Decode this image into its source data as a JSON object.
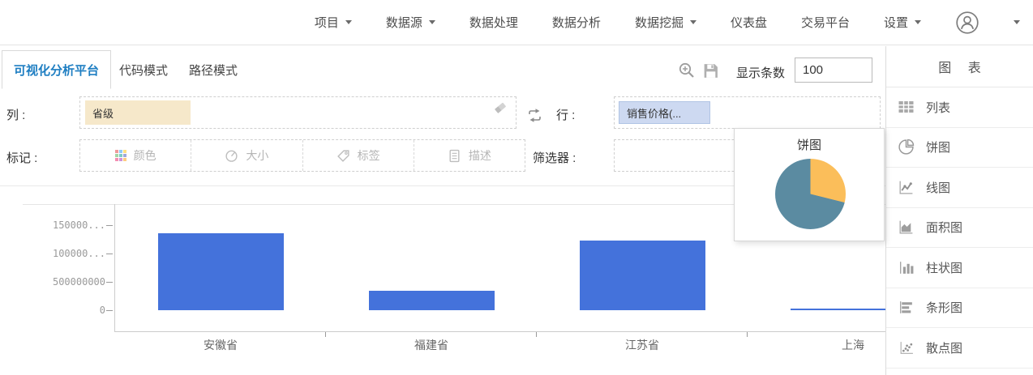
{
  "nav": {
    "items": [
      {
        "label": "项目",
        "has_caret": true
      },
      {
        "label": "数据源",
        "has_caret": true
      },
      {
        "label": "数据处理",
        "has_caret": false
      },
      {
        "label": "数据分析",
        "has_caret": false
      },
      {
        "label": "数据挖掘",
        "has_caret": true
      },
      {
        "label": "仪表盘",
        "has_caret": false
      },
      {
        "label": "交易平台",
        "has_caret": false
      },
      {
        "label": "设置",
        "has_caret": true
      }
    ]
  },
  "tabs": {
    "items": [
      {
        "label": "可视化分析平台",
        "active": true
      },
      {
        "label": "代码模式",
        "active": false
      },
      {
        "label": "路径模式",
        "active": false
      }
    ]
  },
  "toolbar": {
    "zoom_icon": "zoom-in-icon",
    "save_icon": "save-icon",
    "display_count_label": "显示条数",
    "display_count_value": "100"
  },
  "controls": {
    "column_label": "列 :",
    "column_tag": "省级",
    "row_label": "行 :",
    "row_tag": "销售价格(...",
    "marks_label": "标记 :",
    "marks_buttons": [
      {
        "label": "颜色",
        "icon": "color-grid-icon"
      },
      {
        "label": "大小",
        "icon": "size-dial-icon"
      },
      {
        "label": "标签",
        "icon": "tag-icon"
      },
      {
        "label": "描述",
        "icon": "description-icon"
      }
    ],
    "filter_label": "筛选器 :"
  },
  "sidebar": {
    "title": "图 表",
    "items": [
      {
        "label": "列表",
        "icon": "table-icon"
      },
      {
        "label": "饼图",
        "icon": "pie-chart-icon"
      },
      {
        "label": "线图",
        "icon": "line-chart-icon"
      },
      {
        "label": "面积图",
        "icon": "area-chart-icon"
      },
      {
        "label": "柱状图",
        "icon": "column-chart-icon"
      },
      {
        "label": "条形图",
        "icon": "bar-chart-icon"
      },
      {
        "label": "散点图",
        "icon": "scatter-chart-icon"
      }
    ]
  },
  "tooltip": {
    "title": "饼图"
  },
  "chart_data": [
    {
      "type": "bar",
      "title": "",
      "categories": [
        "安徽省",
        "福建省",
        "江苏省",
        "上海"
      ],
      "values": [
        1360000000,
        340000000,
        1230000000,
        29000000
      ],
      "y_axis": {
        "tick_labels": [
          "150000...",
          "100000...",
          "500000000",
          "0"
        ],
        "tick_values": [
          1500000000,
          1000000000,
          500000000,
          0
        ]
      },
      "ylim": [
        0,
        1750000000
      ],
      "xlabel": "",
      "ylabel": "",
      "grid": false,
      "legend": "none",
      "bar_color": "#4472db"
    },
    {
      "type": "pie",
      "title": "饼图",
      "note": "hover preview of pie chart type",
      "slices": [
        {
          "color": "#fbbe5a",
          "fraction": 0.29
        },
        {
          "color": "#5b8ba1",
          "fraction": 0.71
        }
      ]
    }
  ],
  "colors": {
    "accent_blue": "#1e7ec2",
    "bar_blue": "#4472db",
    "column_chip_bg": "#f6e8ca",
    "row_chip_bg": "#cdd9f1",
    "pie_orange": "#fbbe5a",
    "pie_teal": "#5b8ba1"
  }
}
